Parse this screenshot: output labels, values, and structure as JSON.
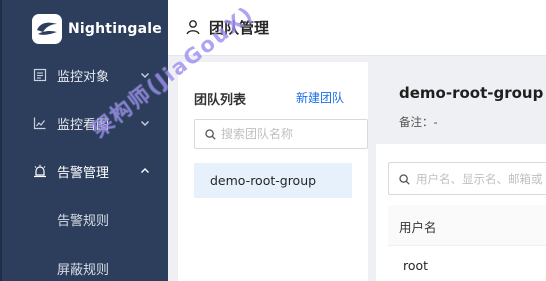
{
  "app": {
    "name": "Nightingale"
  },
  "sidebar": {
    "items": [
      {
        "label": "监控对象",
        "icon": "list-icon"
      },
      {
        "label": "监控看图",
        "icon": "line-chart-icon"
      },
      {
        "label": "告警管理",
        "icon": "alarm-icon"
      }
    ],
    "sub_items": [
      {
        "label": "告警规则"
      },
      {
        "label": "屏蔽规则"
      }
    ]
  },
  "header": {
    "title": "团队管理",
    "icon": "user-icon"
  },
  "team_list": {
    "title": "团队列表",
    "new_label": "新建团队",
    "search_placeholder": "搜索团队名称",
    "teams": [
      "demo-root-group"
    ]
  },
  "team_detail": {
    "name": "demo-root-group",
    "note": "备注：-",
    "search_placeholder": "用户名、显示名、邮箱或",
    "columns": [
      "用户名"
    ],
    "rows": [
      {
        "username": "root"
      }
    ]
  },
  "watermark": {
    "text": "架构师(JiaGouX)"
  },
  "colors": {
    "sidebar_bg": "#2c3e5c",
    "accent": "#1c6fe8",
    "selected_bg": "#e6f1fc",
    "page_bg": "#eef0f3"
  }
}
